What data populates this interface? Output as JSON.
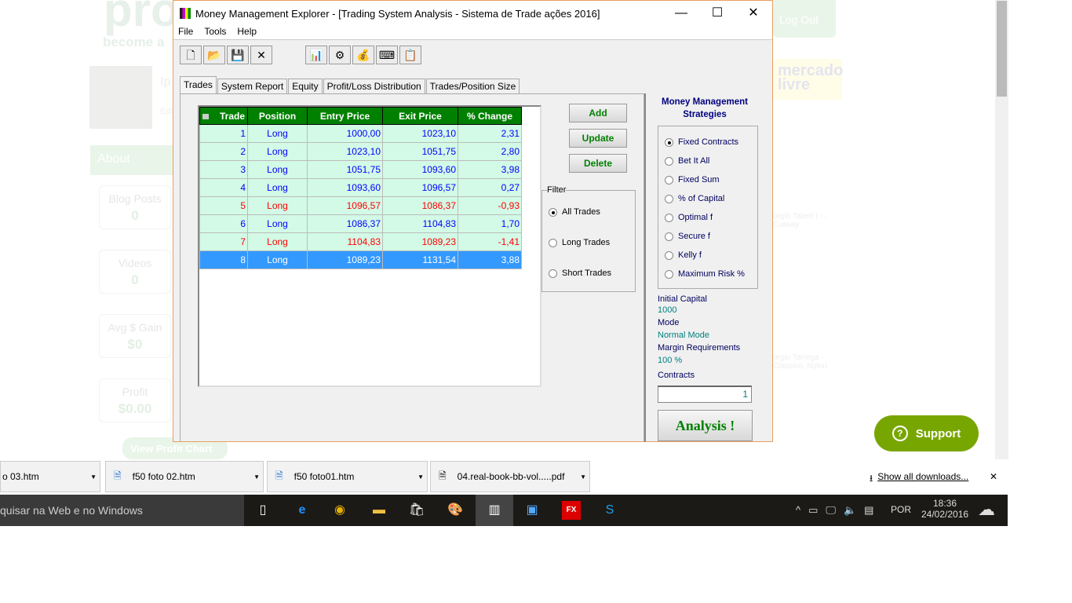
{
  "background": {
    "logo": "pro",
    "tagline": "become a",
    "user_initial": "Ip",
    "edit": "Edi",
    "logout": "Log Out",
    "about": "About",
    "cards": [
      {
        "label": "Blog Posts",
        "value": "0"
      },
      {
        "label": "Videos",
        "value": "0"
      },
      {
        "label": "Avg $ Gain",
        "value": "$0"
      },
      {
        "label": "Profit",
        "value": "$0.00"
      }
    ],
    "view_profit": "View Profit Chart",
    "ad_brand": "mercado livre",
    "ad_items": [
      "orgio Talent I - , Cutway",
      "orgio Tarrega - Clássico, Nylon"
    ],
    "support": "Support"
  },
  "window": {
    "title": "Money Management Explorer - [Trading  System  Analysis - Sistema de Trade ações 2016]",
    "menu": [
      "File",
      "Tools",
      "Help"
    ],
    "tabs": [
      "Trades",
      "System Report",
      "Equity",
      "Profit/Loss Distribution",
      "Trades/Position Size"
    ],
    "columns": [
      "Trade",
      "Position",
      "Entry Price",
      "Exit Price",
      "% Change"
    ],
    "rows": [
      [
        "1",
        "Long",
        "1000,00",
        "1023,10",
        "2,31"
      ],
      [
        "2",
        "Long",
        "1023,10",
        "1051,75",
        "2,80"
      ],
      [
        "3",
        "Long",
        "1051,75",
        "1093,60",
        "3,98"
      ],
      [
        "4",
        "Long",
        "1093,60",
        "1096,57",
        "0,27"
      ],
      [
        "5",
        "Long",
        "1096,57",
        "1086,37",
        "-0,93"
      ],
      [
        "6",
        "Long",
        "1086,37",
        "1104,83",
        "1,70"
      ],
      [
        "7",
        "Long",
        "1104,83",
        "1089,23",
        "-1,41"
      ],
      [
        "8",
        "Long",
        "1089,23",
        "1131,54",
        "3,88"
      ]
    ],
    "buttons": {
      "add": "Add",
      "update": "Update",
      "delete": "Delete",
      "analysis": "Analysis !"
    },
    "filter": {
      "legend": "Filter",
      "options": [
        "All Trades",
        "Long Trades",
        "Short Trades"
      ],
      "selected": "All Trades"
    },
    "strategies": {
      "title": "Money Management Strategies",
      "options": [
        "Fixed Contracts",
        "Bet It All",
        "Fixed Sum",
        "% of Capital",
        "Optimal f",
        "Secure f",
        "Kelly f",
        "Maximum Risk %"
      ],
      "selected": "Fixed Contracts"
    },
    "initial_capital_label": "Initial Capital",
    "initial_capital": "1000",
    "mode_label": "Mode",
    "mode": "Normal Mode",
    "margin_label": "Margin Requirements",
    "margin": "100 %",
    "contracts_label": "Contracts",
    "contracts": "1"
  },
  "downloads": {
    "items": [
      "o 03.htm",
      "f50 foto 02.htm",
      "f50 foto01.htm",
      "04.real-book-bb-vol.....pdf"
    ],
    "show_all": "Show all downloads..."
  },
  "taskbar": {
    "search": "quisar na Web e no Windows",
    "lang": "POR",
    "time": "18:36",
    "date": "24/02/2016"
  }
}
